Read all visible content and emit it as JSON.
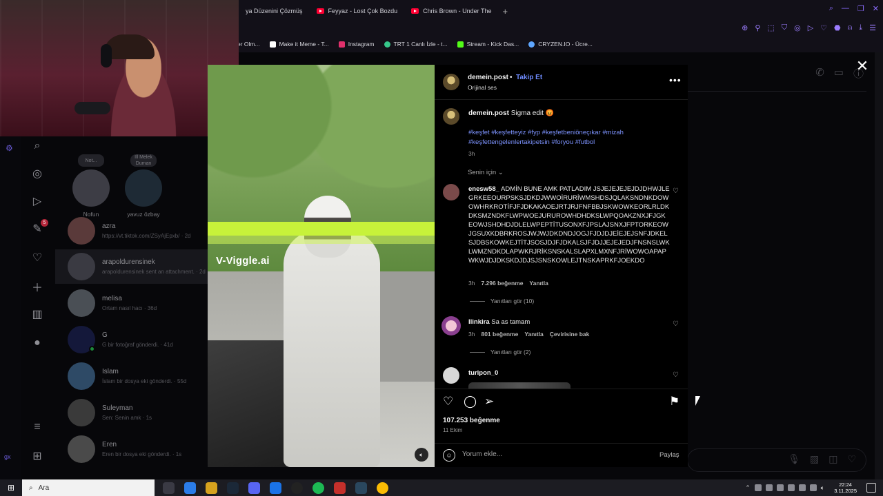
{
  "browser": {
    "tabs": [
      {
        "label": "ya Düzenini Çözmüş",
        "icon": "none"
      },
      {
        "label": "Feyyaz - Lost Çok Bozdu",
        "icon": "youtube-icon"
      },
      {
        "label": "Chris Brown - Under The",
        "icon": "youtube-icon"
      }
    ],
    "new_tab": "+",
    "bookmarks": [
      {
        "label": "er Olm...",
        "color": "#555555"
      },
      {
        "label": "Make it Meme - T...",
        "color": "#ffffff"
      },
      {
        "label": "Instagram",
        "color": "#e1306c"
      },
      {
        "label": "TRT 1 Canlı İzle - t...",
        "color": "#36c78a"
      },
      {
        "label": "Stream - Kick Das...",
        "color": "#53fc18"
      },
      {
        "label": "CRYZEN.IO - Ücre...",
        "color": "#5fa7ff"
      }
    ],
    "accent": "#8b6cff"
  },
  "ig_sidebar": {
    "icons": [
      "search-icon",
      "compass-icon",
      "reels-icon",
      "messenger-icon",
      "heart-icon",
      "plus-icon",
      "stats-icon",
      "profile-icon",
      "menu-icon",
      "grid-icon"
    ],
    "messenger_badge": "5"
  },
  "stories": [
    {
      "bubble": "Not...",
      "name": "Nofun"
    },
    {
      "bubble": "Ill Melek Duman",
      "name": "yavuz özbay"
    }
  ],
  "conversations": [
    {
      "name": "azra",
      "sub": "https://vt.tiktok.com/ZSyAjEpxb/ · 2d",
      "color": "#5a3a3a"
    },
    {
      "name": "arapoldurensinek",
      "sub": "arapoldurensinek sent an attachment. · 2d",
      "color": "#3a3a42"
    },
    {
      "name": "melisa",
      "sub": "Ortam nasıl hacı · 36d",
      "color": "#4a4f55"
    },
    {
      "name": "G",
      "sub": "G bir fotoğraf gönderdi. · 41d",
      "color": "#14183a"
    },
    {
      "name": "İslam",
      "sub": "İslam bir dosya eki gönderdi. · 55d",
      "color": "#2e4a66"
    },
    {
      "name": "Suleyman",
      "sub": "Sen: Senin amk · 1s",
      "color": "#3a3a3a"
    },
    {
      "name": "Eren",
      "sub": "Eren bir dosya eki gönderdi. · 1s",
      "color": "#4a4a4a"
    }
  ],
  "video": {
    "watermark": "V-Viggle.ai"
  },
  "post": {
    "username": "demein.post",
    "dot": "•",
    "follow": "Takip Et",
    "audio": "Orijinal ses",
    "caption_user": "demein.post",
    "caption_text": "Sigma edit 😡",
    "hashtags": "#keşfet #keşfetteyiz #fyp #keşfetbeniöneçıkar #mizah #keşfettengelenlertakipetsin #foryou #futbol",
    "caption_time": "3h",
    "for_you": "Senin için ⌄",
    "likes": "107.253 beğenme",
    "date": "11 Ekim",
    "comment_placeholder": "Yorum ekle...",
    "post_button": "Paylaş"
  },
  "comments": [
    {
      "user": "enesw58_",
      "text": "ADMİN BUNE AMK PATLADIM JSJEJEJEJEJDJDHWJLEGRKEEOURPSKSJDKDJWWOİRURİWMSHDSJQLAKSNDNKDOWOWHRKROTİFJFJDKAKAOEJRTJRJFNFBBJSKWOWKEORLRLDKDKSMZNDKFLWPWOEJURUROWHDHDKSLWPQOAKZNXJFJGKEOWJSHDHDJDLELWPEPTİTUSONXFJPSLAJSNXJFPTORKEOWJGSUXKDBRKROSJWJWJDKDNDJOGJFJDJDJEİEJEJSNFJDKELSJDBSKOWKEJTİTJSOSJDJFJDKALSJFJDJJEJEJEDJFNSNSLWKLWMZNDKDLAPWKRJRİKSNSKALSLAPXLMXNFJRİWOWOAPAPWKWJDJDKSKDJDJSJSNSKOWLEJTNSKAPRKFJOEKDO",
      "time": "3h",
      "likes": "7.296 beğenme",
      "reply": "Yanıtla",
      "view_replies": "Yanıtları gör (10)"
    },
    {
      "user": "llinkira",
      "text": "Sa as tamam",
      "time": "3h",
      "likes": "801 beğenme",
      "reply": "Yanıtla",
      "translate": "Çevirisine bak",
      "view_replies": "Yanıtları gör (2)"
    },
    {
      "user": "turipon_0",
      "text": ""
    }
  ],
  "taskbar": {
    "search_placeholder": "Ara",
    "time": "22:24",
    "date": "3.11.2025",
    "apps": [
      "#3a3a44",
      "#2b7de9",
      "#d6a21e",
      "#1b2838",
      "#5865f2",
      "#1a73e8",
      "#222",
      "#1db954",
      "#c4302b",
      "#2a475e",
      "#fbbc04"
    ]
  }
}
